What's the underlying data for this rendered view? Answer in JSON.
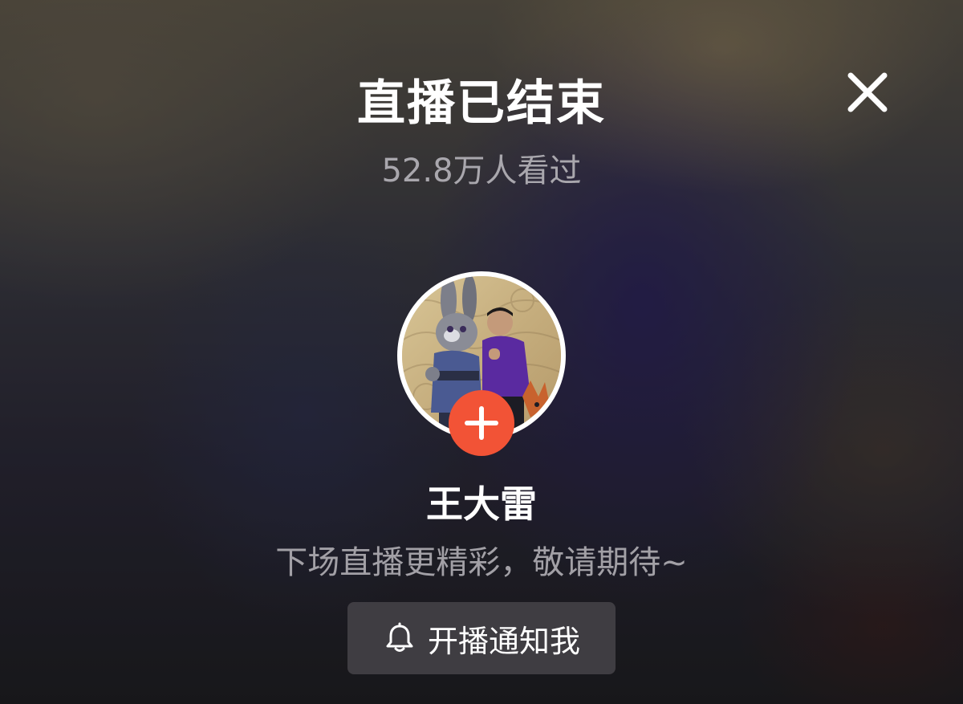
{
  "title": "直播已结束",
  "viewers": "52.8万人看过",
  "streamer": {
    "name": "王大雷",
    "message": "下场直播更精彩，敬请期待~"
  },
  "notify_button": {
    "label": "开播通知我",
    "icon": "bell-icon"
  },
  "close_icon": "close-icon",
  "follow_icon": "plus-icon",
  "colors": {
    "accent": "#f25336",
    "title_text": "#ffffff",
    "secondary_text": "#a9a7ad",
    "button_bg": "#48464a"
  }
}
